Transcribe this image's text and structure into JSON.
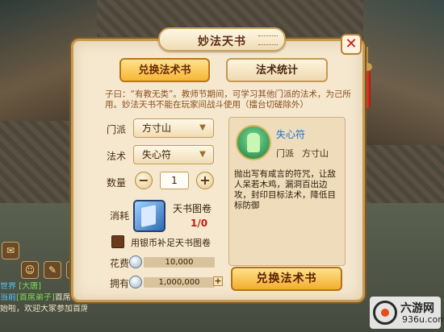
{
  "dialog": {
    "title": "妙法天书",
    "tabs": {
      "active": "兑换法术书",
      "inactive": "法术统计"
    },
    "description": "子曰：“有教无类”。教师节期间，可学习其他门派的法术，为己所用。妙法天书不能在玩家间战斗使用（擂台切磋除外）"
  },
  "form": {
    "school_label": "门派",
    "school_value": "方寸山",
    "spell_label": "法术",
    "spell_value": "失心符",
    "quantity_label": "数量",
    "quantity_value": "1",
    "cost_label": "消耗",
    "item_name": "天书图卷",
    "item_count": "1/0",
    "silver_option": "用银币补足天书图卷",
    "fee_label": "花费",
    "fee_value": "10,000",
    "own_label": "拥有",
    "own_value": "1,000,000"
  },
  "spell_info": {
    "name": "失心符",
    "school_label": "门派",
    "school": "方寸山",
    "description": "抛出写有咸言的符咒，让敌人呆若木鸡，漏洞百出边攻，封印目标法术，降低目标防御"
  },
  "actions": {
    "redeem": "兑换法术书"
  },
  "hud": {
    "chat": [
      {
        "channel": "世界",
        "name": "[大唐]",
        "text": ""
      },
      {
        "channel": "当前",
        "name": "[首席弟子]",
        "text": "首席弟子竞选报名开"
      },
      {
        "channel": "",
        "name": "",
        "text": "始啦，欢迎大家参加首席弟子竞选！"
      }
    ],
    "icons": [
      "chat-icon",
      "friends-icon",
      "mail-icon",
      "team-icon"
    ]
  },
  "watermark": {
    "brand": "六游网",
    "url": "936u.com"
  },
  "colors": {
    "accent": "#f4ad2d",
    "frame": "#c79a52",
    "panel": "#f5e8cf",
    "highlight_red": "#c01e12",
    "link_blue": "#1c6fd1"
  }
}
